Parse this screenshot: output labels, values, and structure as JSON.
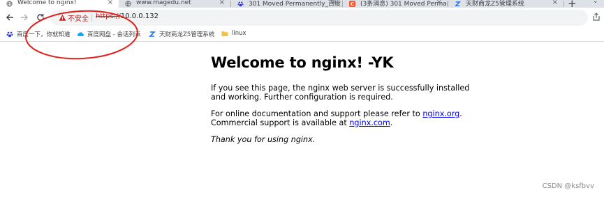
{
  "tabs": [
    {
      "title": "Welcome to nginx!",
      "active": true,
      "favicon": "globe-icon"
    },
    {
      "title": "www.magedu.net",
      "active": false,
      "favicon": "globe-icon"
    },
    {
      "title": "301 Moved Permanently_百度",
      "active": false,
      "favicon": "baidu-paw-icon"
    },
    {
      "title": "(3条消息) 301 Moved Permane",
      "active": false,
      "favicon": "csdn-c-icon"
    },
    {
      "title": "天财商龙Z5管理系统",
      "active": false,
      "favicon": "z5-icon"
    }
  ],
  "tab_close_glyph": "×",
  "new_tab_glyph": "+",
  "tab_menu_glyph": "⌄",
  "address": {
    "security_label": "不安全",
    "url_scheme": "https://",
    "url_host": "10.0.0.132"
  },
  "bookmarks": [
    {
      "label": "百度一下，你就知道",
      "icon": "baidu-paw-icon"
    },
    {
      "label": "百度网盘 - 会话列表",
      "icon": "baidu-netdisk-icon"
    },
    {
      "label": "天财商龙Z5管理系统",
      "icon": "z5-icon"
    },
    {
      "label": "linux",
      "icon": "folder-icon"
    }
  ],
  "page": {
    "heading": "Welcome to nginx! -YK",
    "p1": "If you see this page, the nginx web server is successfully installed and working. Further configuration is required.",
    "p2_before": "For online documentation and support please refer to ",
    "p2_link1": "nginx.org",
    "p2_middle": ".\nCommercial support is available at ",
    "p2_link2": "nginx.com",
    "p2_after": ".",
    "thanks": "Thank you for using nginx."
  },
  "watermark": "CSDN @ksfbvv",
  "colors": {
    "tabstrip_bg": "#dee1e6",
    "omnibox_bg": "#f1f3f4",
    "insecure_red": "#c5221f",
    "link_blue": "#0000ee",
    "annotation_red": "#e0201b",
    "csdn_orange": "#fc5531",
    "baidu_blue": "#2932e1"
  }
}
